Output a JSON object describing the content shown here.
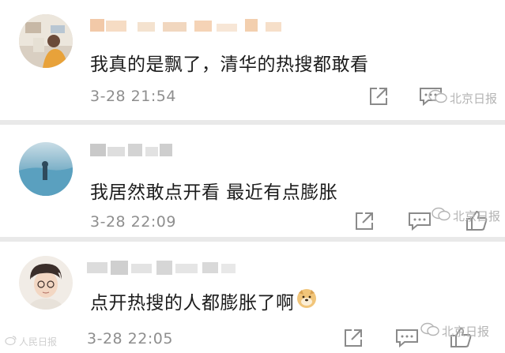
{
  "comments": [
    {
      "text": "我真的是飘了，清华的热搜都敢看",
      "time": "3-28 21:54"
    },
    {
      "text": "我居然敢点开看 最近有点膨胀",
      "time": "3-28 22:09"
    },
    {
      "text": "点开热搜的人都膨胀了啊",
      "emoji": "doge-emoji",
      "time": "3-28 22:05"
    }
  ],
  "watermark": {
    "text": "北京日报"
  },
  "corner_watermark": {
    "text": "人民日报"
  },
  "icons": {
    "share": "share-icon",
    "reply": "comment-icon",
    "like": "thumbs-up-icon",
    "watermark": "wechat-icon"
  },
  "colors": {
    "card_bg": "#ffffff",
    "separator": "#e9e9e9",
    "meta_text": "#8e8e8e",
    "icon_gray": "#8a8a8a",
    "watermark": "#b4b4b4"
  }
}
